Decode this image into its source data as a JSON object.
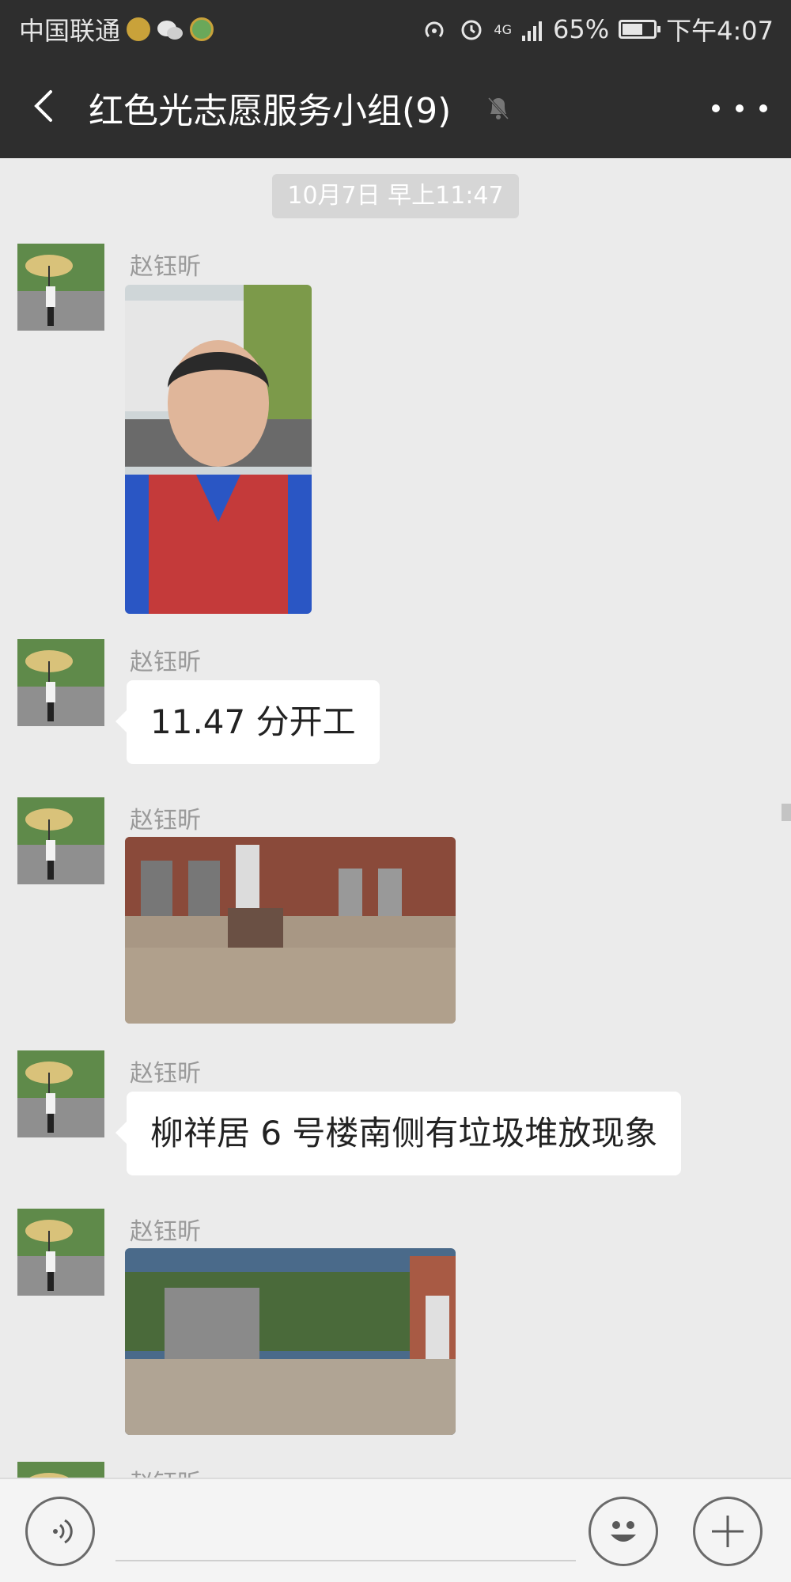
{
  "status_bar": {
    "carrier": "中国联通",
    "network": "4G",
    "battery": "65%",
    "battery_level": 0.65,
    "time": "下午4:07"
  },
  "header": {
    "title": "红色光志愿服务小组(9)",
    "back_icon": "chevron-left-icon",
    "mute_icon": "bell-muted-icon",
    "more_icon": "more-dots-icon"
  },
  "chat": {
    "timestamp": "10月7日 早上11:47",
    "messages": [
      {
        "sender": "赵钰昕",
        "type": "image",
        "image": "selfie-in-red-vest"
      },
      {
        "sender": "赵钰昕",
        "type": "text",
        "text": "11.47 分开工"
      },
      {
        "sender": "赵钰昕",
        "type": "image",
        "image": "street-with-trash-pile"
      },
      {
        "sender": "赵钰昕",
        "type": "text",
        "text": "柳祥居 6 号楼南侧有垃圾堆放现象"
      },
      {
        "sender": "赵钰昕",
        "type": "image",
        "image": "gate-and-courtyard"
      },
      {
        "sender": "赵钰昕",
        "type": "partial"
      }
    ]
  },
  "input_bar": {
    "voice_icon": "voice-icon",
    "emoji_icon": "emoji-icon",
    "plus_icon": "plus-icon",
    "input_value": ""
  },
  "colors": {
    "header_bg": "#2e2e2e",
    "chat_bg": "#ebebeb",
    "bubble_bg": "#ffffff",
    "timestamp_bg": "#d6d6d6",
    "input_bar_bg": "#f4f4f4"
  }
}
